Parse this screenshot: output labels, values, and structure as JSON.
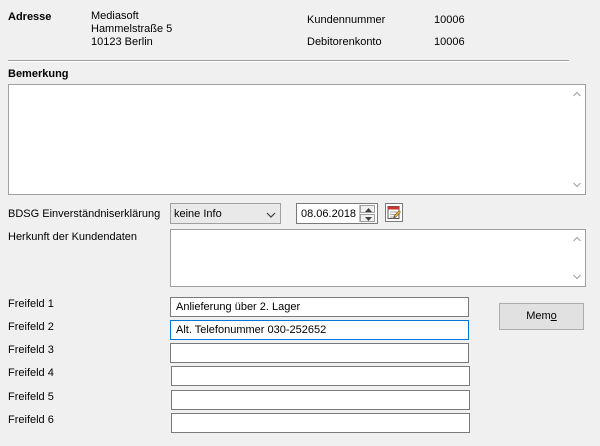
{
  "address": {
    "heading": "Adresse",
    "lines": [
      "Mediasoft",
      "Hammelstraße 5",
      "10123 Berlin"
    ]
  },
  "customer": {
    "number_label": "Kundennummer",
    "number_value": "10006",
    "account_label": "Debitorenkonto",
    "account_value": "10006"
  },
  "remark": {
    "heading": "Bemerkung",
    "value": ""
  },
  "consent": {
    "label": "BDSG Einverständniserklärung",
    "selected": "keine Info",
    "date": "08.06.2018"
  },
  "origin": {
    "label": "Herkunft der Kundendaten",
    "value": ""
  },
  "free_fields": [
    {
      "label": "Freifeld 1",
      "value": "Anlieferung über 2. Lager"
    },
    {
      "label": "Freifeld 2",
      "value": "Alt. Telefonummer 030-252652"
    },
    {
      "label": "Freifeld 3",
      "value": ""
    },
    {
      "label": "Freifeld 4",
      "value": ""
    },
    {
      "label": "Freifeld 5",
      "value": ""
    },
    {
      "label": "Freifeld 6",
      "value": ""
    }
  ],
  "memo_button": {
    "prefix": "Mem",
    "accel": "o"
  },
  "icons": {
    "scroll_up": "chevron-up-icon",
    "scroll_down": "chevron-down-icon",
    "combo": "chevron-down-icon",
    "calendar": "calendar-icon"
  }
}
